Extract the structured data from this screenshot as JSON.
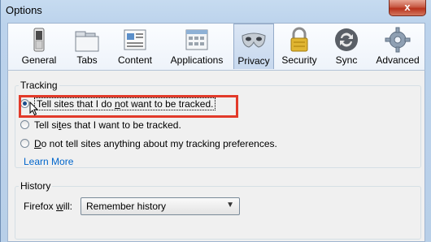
{
  "window": {
    "title": "Options",
    "close_glyph": "x"
  },
  "toolbar": {
    "panes": [
      {
        "label": "General",
        "icon": "switch-icon"
      },
      {
        "label": "Tabs",
        "icon": "tabs-icon"
      },
      {
        "label": "Content",
        "icon": "content-icon"
      },
      {
        "label": "Applications",
        "icon": "applications-icon"
      },
      {
        "label": "Privacy",
        "icon": "mask-icon",
        "selected": true
      },
      {
        "label": "Security",
        "icon": "padlock-icon"
      },
      {
        "label": "Sync",
        "icon": "sync-icon"
      },
      {
        "label": "Advanced",
        "icon": "gear-icon"
      }
    ]
  },
  "tracking": {
    "legend": "Tracking",
    "options": [
      {
        "pre": "Tell sites that I do ",
        "ul": "n",
        "post": "ot want to be tracked.",
        "checked": true
      },
      {
        "pre": "Tell si",
        "ul": "t",
        "post": "es that I want to be tracked.",
        "checked": false
      },
      {
        "pre": "",
        "ul": "D",
        "post": "o not tell sites anything about my tracking preferences.",
        "checked": false
      }
    ],
    "learn_more": "Learn More"
  },
  "history": {
    "legend": "History",
    "label_pre": "Firefox ",
    "label_ul": "w",
    "label_post": "ill:",
    "select_value": "Remember history"
  },
  "colors": {
    "highlight": "#e23a2a",
    "link": "#0066cc"
  }
}
